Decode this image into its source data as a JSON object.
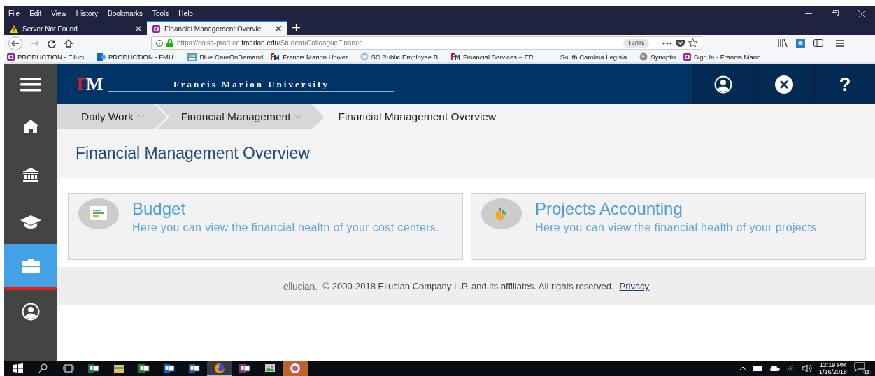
{
  "browser": {
    "menu": [
      "File",
      "Edit",
      "View",
      "History",
      "Bookmarks",
      "Tools",
      "Help"
    ],
    "tabs": [
      {
        "label": "Server Not Found",
        "kind": "warning",
        "selected": false
      },
      {
        "label": "Financial Management Overvie",
        "kind": "ellucian",
        "selected": true
      }
    ],
    "url": {
      "prefix": "https://colss-prod.ec.",
      "domain": "fmarion.edu",
      "path": "/Student/ColleagueFinance"
    },
    "zoom": "140%",
    "bookmarks": [
      {
        "label": "PRODUCTION - Elluci...",
        "kind": "ellucian"
      },
      {
        "label": "PRODUCTION - FMU ...",
        "kind": "sharepoint"
      },
      {
        "label": "Blue CareOnDemand",
        "kind": "people"
      },
      {
        "label": "Francis Marion Univer...",
        "kind": "fm"
      },
      {
        "label": "SC Public Employee B...",
        "kind": "globe"
      },
      {
        "label": "Financial Services – ER...",
        "kind": "fm"
      },
      {
        "label": "South Carolina Legisla...",
        "kind": "none"
      },
      {
        "label": "Synoptix",
        "kind": "synoptix"
      },
      {
        "label": "Sign In - Francis Mario...",
        "kind": "ellucian"
      }
    ]
  },
  "app": {
    "logo": "FM",
    "university": "Francis Marion University",
    "header_buttons": [
      {
        "kind": "user"
      },
      {
        "kind": "close"
      },
      {
        "kind": "help",
        "label": "?"
      }
    ],
    "sidebar": [
      {
        "kind": "menu",
        "selected": false
      },
      {
        "kind": "home",
        "selected": false
      },
      {
        "kind": "bank",
        "selected": false
      },
      {
        "kind": "graduation",
        "selected": false
      },
      {
        "kind": "briefcase",
        "selected": true
      },
      {
        "kind": "user",
        "selected": false
      }
    ],
    "breadcrumbs": [
      {
        "label": "Daily Work",
        "selected": false
      },
      {
        "label": "Financial Management",
        "selected": false
      },
      {
        "label": "Financial Management Overview",
        "selected": true
      }
    ],
    "title": "Financial Management Overview",
    "cards": [
      {
        "kind": "budget",
        "title": "Budget",
        "description": "Here you can view the financial health of your cost centers."
      },
      {
        "kind": "projects",
        "title": "Projects Accounting",
        "description": "Here you can view the financial health of your projects."
      }
    ],
    "footer": {
      "brand": "ellucian.",
      "copyright": "© 2000-2018 Ellucian Company L.P. and its affiliates. All rights reserved.",
      "link": "Privacy"
    }
  },
  "taskbar": {
    "apps": [
      {
        "kind": "excel",
        "selected": false
      },
      {
        "kind": "explorer",
        "selected": false
      },
      {
        "kind": "project",
        "selected": false
      },
      {
        "kind": "outlook",
        "selected": false
      },
      {
        "kind": "word",
        "selected": false
      },
      {
        "kind": "firefox",
        "selected": true
      },
      {
        "kind": "onenote",
        "selected": false
      },
      {
        "kind": "photos",
        "selected": false
      },
      {
        "kind": "itunes",
        "selected": false
      }
    ],
    "time": "12:19 PM",
    "date": "1/16/2018",
    "notifications": "15"
  }
}
